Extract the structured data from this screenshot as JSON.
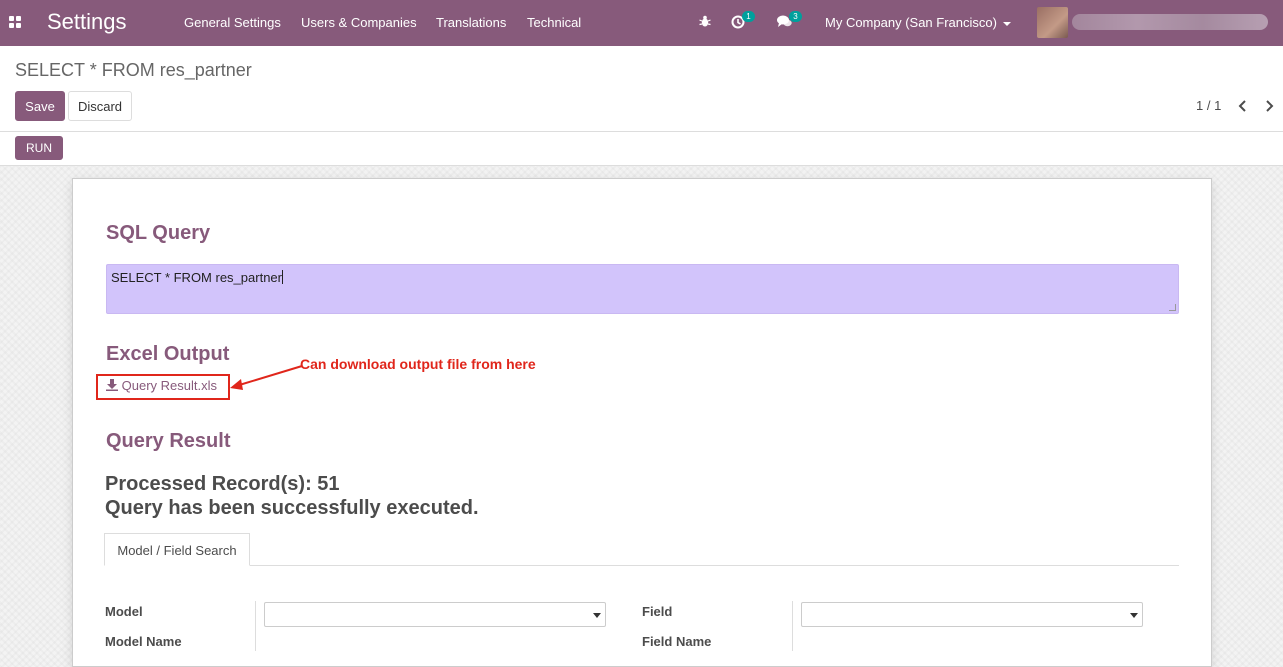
{
  "navbar": {
    "app_title": "Settings",
    "menu": [
      "General Settings",
      "Users & Companies",
      "Translations",
      "Technical"
    ],
    "activity_count": "1",
    "messages_count": "3",
    "company": "My Company (San Francisco)"
  },
  "control_panel": {
    "breadcrumb": "SELECT * FROM res_partner",
    "save_label": "Save",
    "discard_label": "Discard",
    "pager": "1 / 1",
    "run_label": "RUN"
  },
  "form": {
    "sql_section_title": "SQL Query",
    "sql_query": "SELECT * FROM res_partner",
    "excel_section_title": "Excel Output",
    "download_label": "Query Result.xls",
    "annotation": "Can download output file from here",
    "result_section_title": "Query Result",
    "processed_records": "Processed Record(s): 51",
    "status_message": "Query has been successfully executed.",
    "tab_label": "Model / Field Search",
    "model_label": "Model",
    "model_name_label": "Model Name",
    "field_label": "Field",
    "field_name_label": "Field Name"
  },
  "colors": {
    "brand": "#875a7b",
    "sql_box_bg": "#d2c4fb",
    "annotation_red": "#e0261b",
    "badge": "#00a09d"
  }
}
